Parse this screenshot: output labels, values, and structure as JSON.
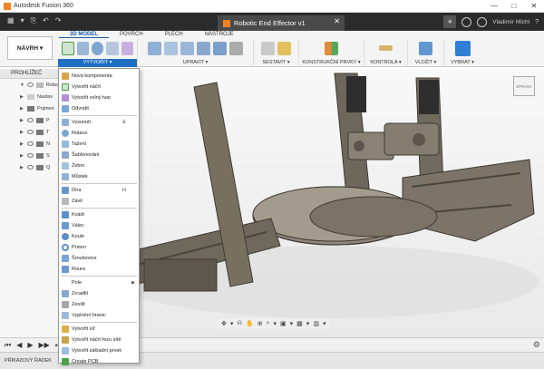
{
  "app": {
    "title": "Autodesk Fusion 360"
  },
  "window_controls": [
    "—",
    "□",
    "✕"
  ],
  "tab": {
    "doc_title": "Robotic End Effector v1",
    "close": "✕",
    "new_tab": "+",
    "user": "Vladimír Michl",
    "help": "?"
  },
  "qat": [
    "▦",
    "▾",
    "⎘",
    "↶",
    "↷"
  ],
  "workspace": {
    "label": "NÁVRH ▾"
  },
  "modes": [
    "3D MODEL",
    "POVRCH",
    "PLECH",
    "NÁSTROJE"
  ],
  "groups": [
    "VYTVOŘIT ▾",
    "UPRAVIT ▾",
    "SESTAVIT ▾",
    "KONSTRUKČNÍ PRVKY ▾",
    "KONTROLA ▾",
    "VLOŽIT ▾",
    "VYBRAT ▾"
  ],
  "browser": {
    "header": "PROHLÍŽEČ",
    "nodes": [
      "Robo",
      "Nastav",
      "Pojmen",
      "P",
      "T",
      "N",
      "S",
      "Q"
    ]
  },
  "menu": {
    "items": [
      {
        "label": "Nová komponenta",
        "shortcut": ""
      },
      {
        "label": "Vytvořit náčrt",
        "shortcut": ""
      },
      {
        "label": "Vytvořit volný tvar",
        "shortcut": ""
      },
      {
        "label": "Odvodit",
        "shortcut": ""
      },
      {
        "label": "Vysunutí",
        "shortcut": "E"
      },
      {
        "label": "Rotace",
        "shortcut": ""
      },
      {
        "label": "Tažení",
        "shortcut": ""
      },
      {
        "label": "Šablonování",
        "shortcut": ""
      },
      {
        "label": "Žebro",
        "shortcut": ""
      },
      {
        "label": "Můstek",
        "shortcut": ""
      },
      {
        "label": "Díra",
        "shortcut": "H"
      },
      {
        "label": "Závit",
        "shortcut": ""
      },
      {
        "label": "Kvádr",
        "shortcut": ""
      },
      {
        "label": "Válec",
        "shortcut": ""
      },
      {
        "label": "Koule",
        "shortcut": ""
      },
      {
        "label": "Prsten",
        "shortcut": ""
      },
      {
        "label": "Šroubovice",
        "shortcut": ""
      },
      {
        "label": "Roura",
        "shortcut": ""
      },
      {
        "label": "Pole",
        "shortcut": "▶"
      },
      {
        "label": "Zrcadlit",
        "shortcut": ""
      },
      {
        "label": "Zesílit",
        "shortcut": ""
      },
      {
        "label": "Vyplnění hranic",
        "shortcut": ""
      },
      {
        "label": "Vytvořit síť",
        "shortcut": ""
      },
      {
        "label": "Vytvořit náčrt řezu sítě",
        "shortcut": ""
      },
      {
        "label": "Vytvořit základní prvek",
        "shortcut": ""
      },
      {
        "label": "Create PCB",
        "shortcut": ""
      }
    ]
  },
  "viewcube": {
    "label": "ZPRAVA"
  },
  "navbar": [
    "✥",
    "▾",
    "⎌",
    "✋",
    "⊕",
    "⌕",
    "▾",
    "▣",
    "▾",
    "▦",
    "▾",
    "▥",
    "▾"
  ],
  "timeline": [
    "⏮",
    "◀",
    "▶",
    "▶▶",
    "⏭"
  ],
  "settings_icon": "⚙",
  "cmdline": {
    "label": "PŘÍKAZOVÝ ŘÁDEK"
  },
  "colors": {
    "accent": "#1e6fc4",
    "ribbon_bg": "#f4f4f4",
    "tabbar_bg": "#2b2b2b",
    "model": "#7c7468"
  }
}
